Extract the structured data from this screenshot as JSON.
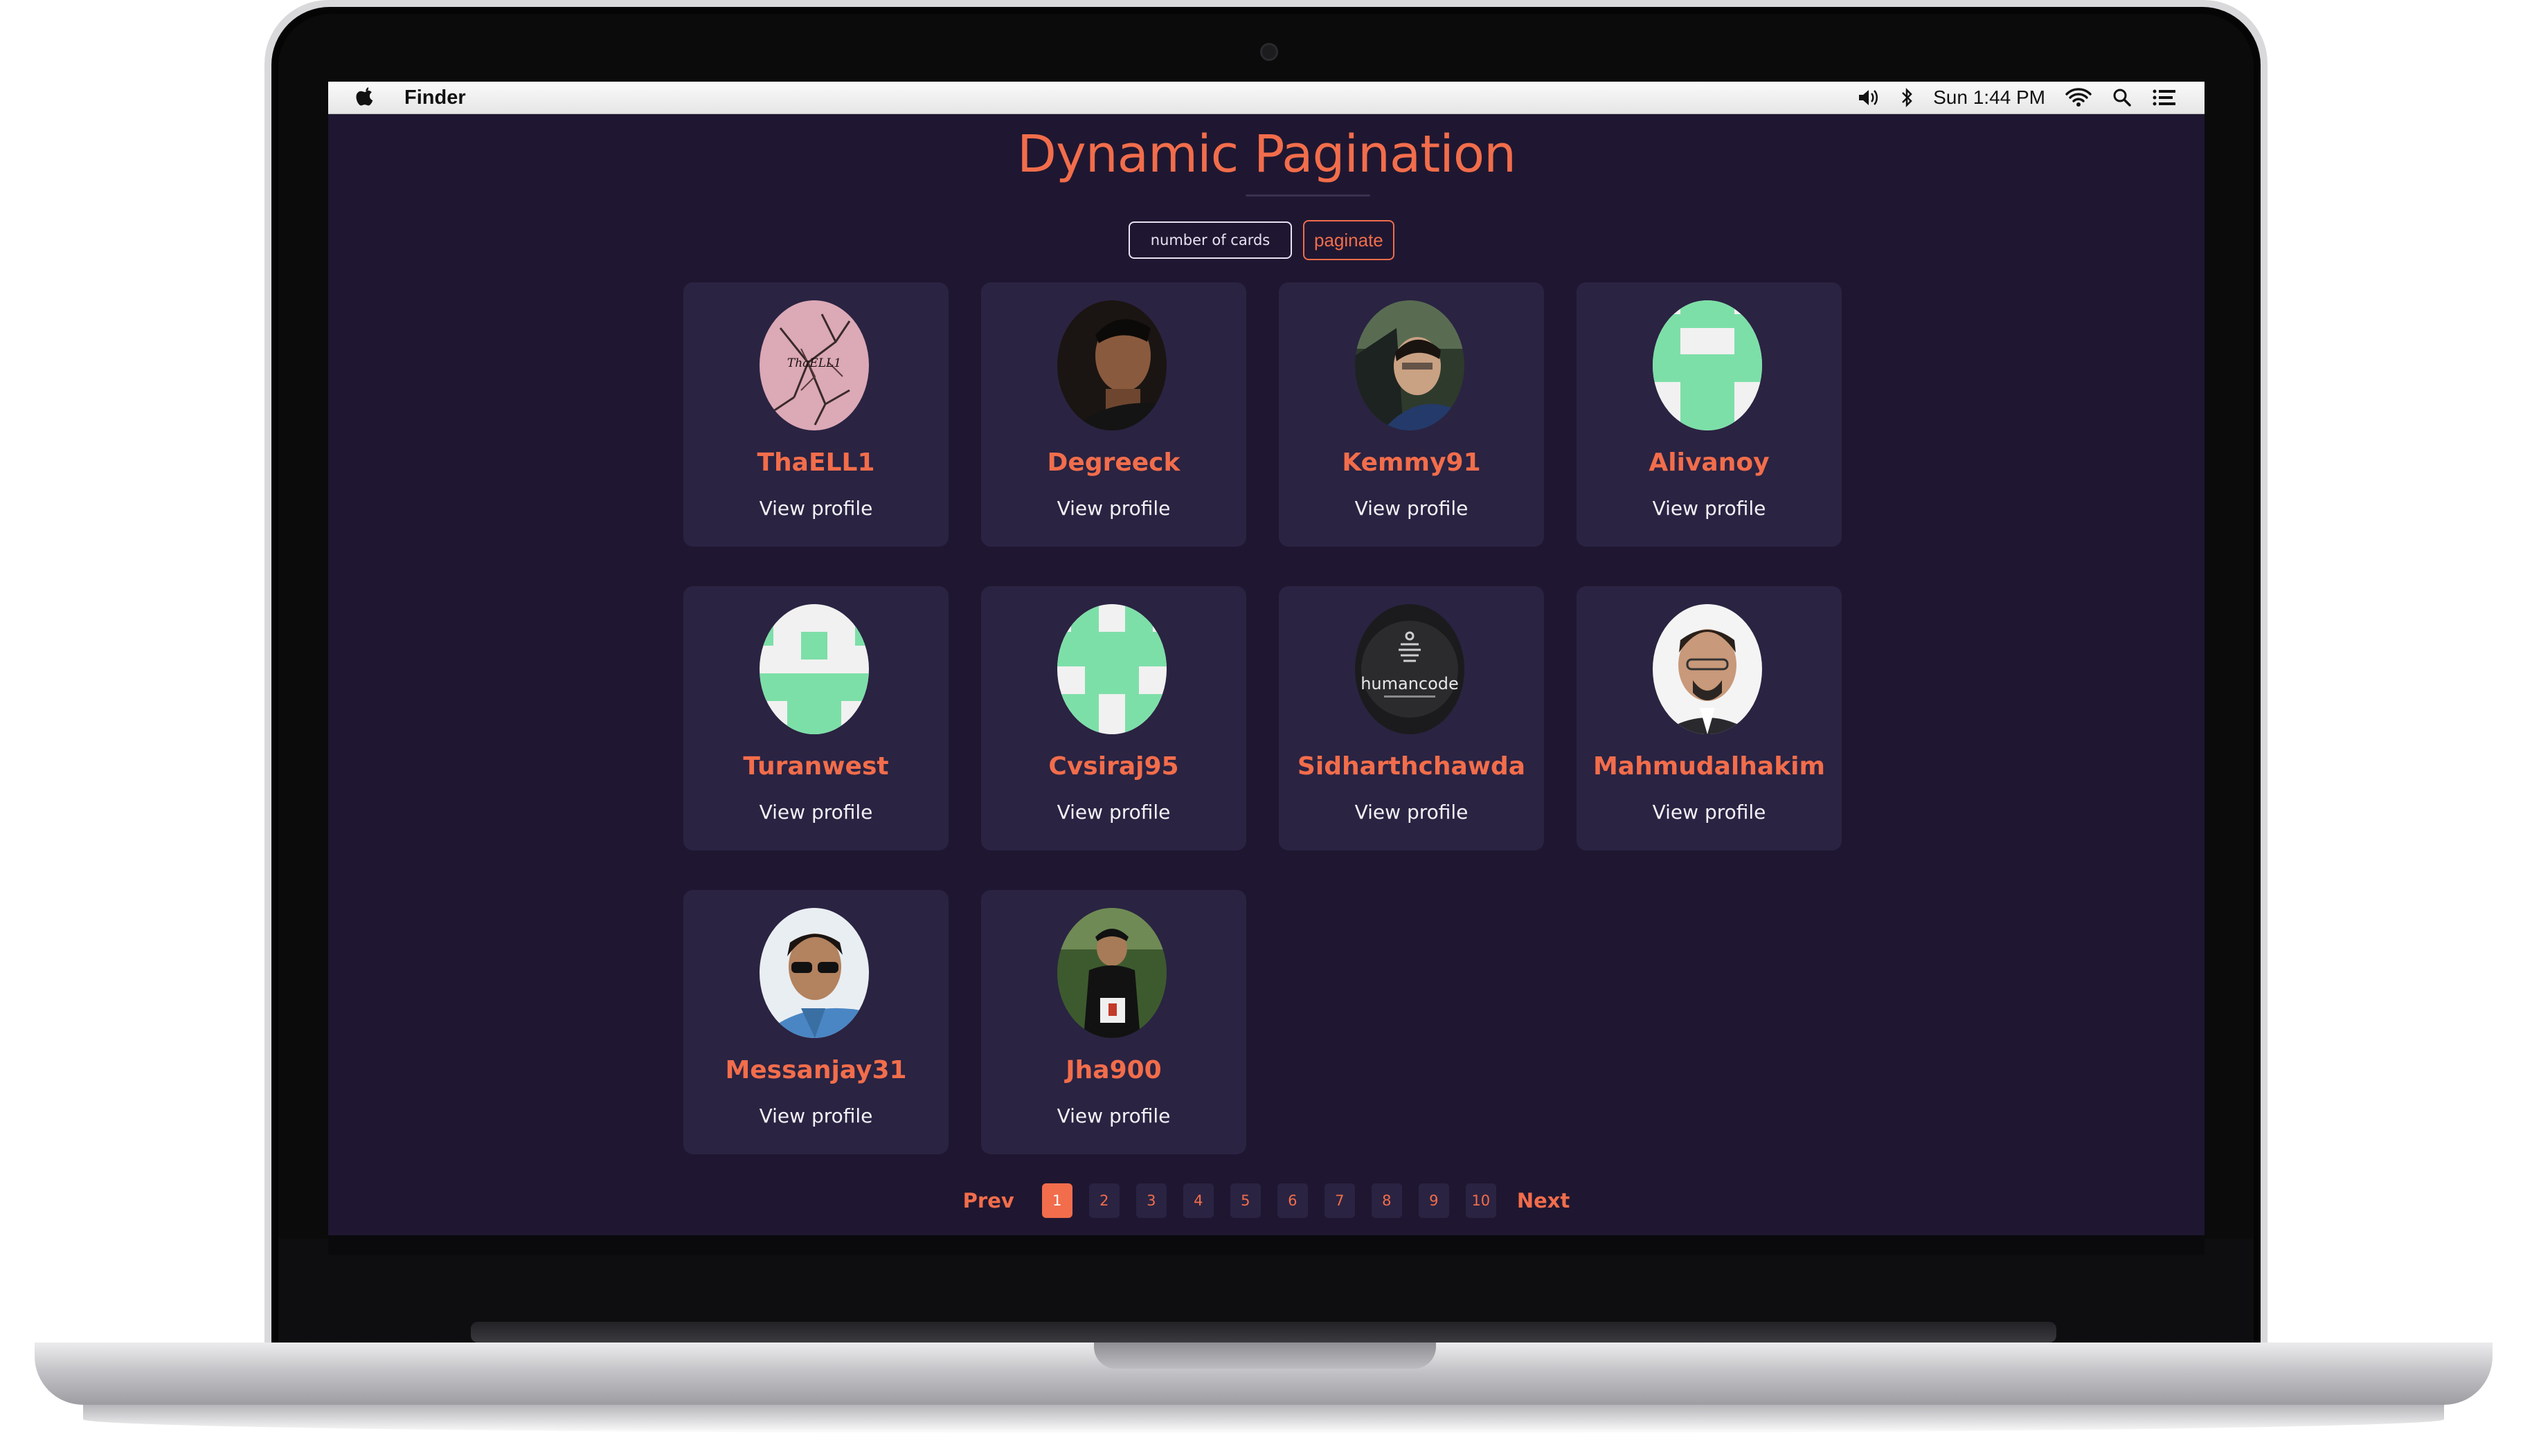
{
  "menubar": {
    "app_name": "Finder",
    "clock": "Sun 1:44 PM",
    "icons": [
      "apple-icon",
      "volume-icon",
      "bluetooth-icon",
      "wifi-icon",
      "search-icon",
      "list-icon"
    ]
  },
  "page": {
    "title": "Dynamic Pagination",
    "input_placeholder": "number of cards",
    "button_label": "paginate"
  },
  "cards": [
    {
      "name": "ThaELL1",
      "link": "View profile",
      "avatar": "pink-sketch"
    },
    {
      "name": "Degreeck",
      "link": "View profile",
      "avatar": "photo-man"
    },
    {
      "name": "Kemmy91",
      "link": "View profile",
      "avatar": "photo-car"
    },
    {
      "name": "Alivanoy",
      "link": "View profile",
      "avatar": "identicon-green"
    },
    {
      "name": "Turanwest",
      "link": "View profile",
      "avatar": "identicon-green"
    },
    {
      "name": "Cvsiraj95",
      "link": "View profile",
      "avatar": "identicon-green"
    },
    {
      "name": "Sidharthchawda",
      "link": "View profile",
      "avatar": "humancode-logo"
    },
    {
      "name": "Mahmudalhakim",
      "link": "View profile",
      "avatar": "photo-man"
    },
    {
      "name": "Messanjay31",
      "link": "View profile",
      "avatar": "photo-sunglasses"
    },
    {
      "name": "Jha900",
      "link": "View profile",
      "avatar": "photo-runner"
    }
  ],
  "avatar_text": {
    "humancode": "humancode",
    "thaell": "ThaELL1"
  },
  "pagination": {
    "prev_label": "Prev",
    "next_label": "Next",
    "pages": [
      "1",
      "2",
      "3",
      "4",
      "5",
      "6",
      "7",
      "8",
      "9",
      "10"
    ],
    "current_page": "1"
  },
  "colors": {
    "background": "#1f1731",
    "card": "#2a2342",
    "accent": "#f26d4b",
    "identicon": "#7ddfa8"
  }
}
